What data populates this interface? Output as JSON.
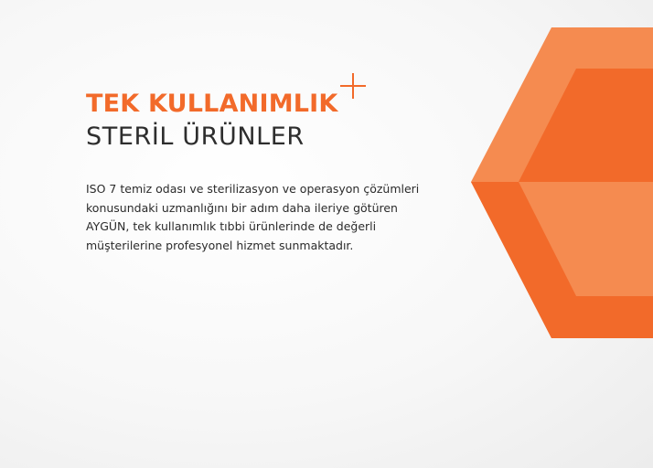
{
  "heading": {
    "line1": "TEK KULLANIMLIK",
    "line2": "STERİL ÜRÜNLER"
  },
  "body": {
    "lines": [
      "ISO 7 temiz odası ve sterilizasyon ve operasyon çözümleri",
      "konusundaki uzmanlığını bir adım daha ileriye götüren",
      "AYGÜN, tek kullanımlık tıbbi ürünlerinde de değerli",
      "müşterilerine profesyonel hizmet sunmaktadır."
    ]
  },
  "colors": {
    "accent": "#f26a2a",
    "accent_light": "#f58b50",
    "text_dark": "#2d2d2d"
  },
  "icons": {
    "plus": "plus-icon",
    "hexagon": "hexagon-graphic"
  }
}
